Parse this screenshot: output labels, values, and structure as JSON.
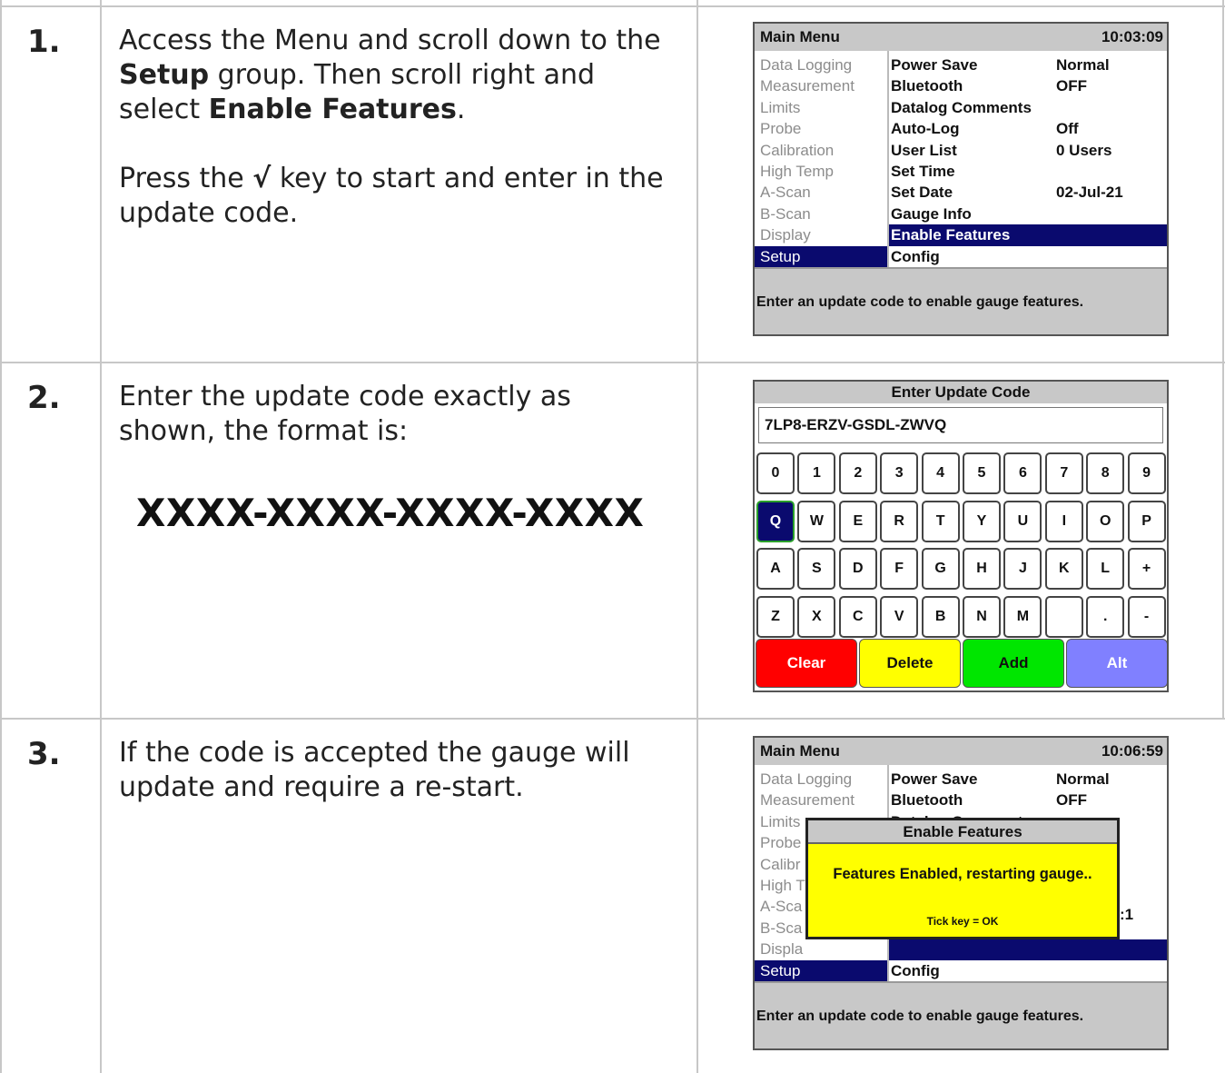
{
  "steps": [
    {
      "number": "1.",
      "p1_before": "Access the Menu and scroll down to the ",
      "p1_bold1": "Setup",
      "p1_middle": " group. Then scroll right and select ",
      "p1_bold2": "Enable Features",
      "p1_after": ".",
      "p2_before": "Press the ",
      "p2_symbol": "√",
      "p2_after": " key to start and enter in the update code."
    },
    {
      "number": "2.",
      "text": "Enter the update code exactly as shown, the format is:",
      "format": "XXXX-XXXX-XXXX-XXXX"
    },
    {
      "number": "3.",
      "text": "If the code is accepted the gauge will update and require a re-start."
    }
  ],
  "screen1": {
    "title": "Main Menu",
    "time": "10:03:09",
    "left_menu": [
      "Data Logging",
      "Measurement",
      "Limits",
      "Probe",
      "Calibration",
      "High Temp",
      "A-Scan",
      "B-Scan",
      "Display",
      "Setup"
    ],
    "right_menu": [
      {
        "label": "Power Save",
        "value": "Normal"
      },
      {
        "label": "Bluetooth",
        "value": "OFF"
      },
      {
        "label": "Datalog Comments",
        "value": ""
      },
      {
        "label": "Auto-Log",
        "value": "Off"
      },
      {
        "label": "User List",
        "value": "0 Users"
      },
      {
        "label": "Set Time",
        "value": ""
      },
      {
        "label": "Set Date",
        "value": "02-Jul-21"
      },
      {
        "label": "Gauge Info",
        "value": ""
      },
      {
        "label": "Enable Features",
        "value": ""
      },
      {
        "label": "Config",
        "value": ""
      }
    ],
    "footer": "Enter an update code to enable gauge features."
  },
  "screen2": {
    "title": "Enter Update Code",
    "input_value": "7LP8-ERZV-GSDL-ZWVQ",
    "rows": [
      [
        "0",
        "1",
        "2",
        "3",
        "4",
        "5",
        "6",
        "7",
        "8",
        "9"
      ],
      [
        "Q",
        "W",
        "E",
        "R",
        "T",
        "Y",
        "U",
        "I",
        "O",
        "P"
      ],
      [
        "A",
        "S",
        "D",
        "F",
        "G",
        "H",
        "J",
        "K",
        "L",
        "+"
      ],
      [
        "Z",
        "X",
        "C",
        "V",
        "B",
        "N",
        "M",
        "",
        ".",
        "-"
      ]
    ],
    "function_keys": [
      {
        "label": "Clear",
        "bg": "#ff0000",
        "fg": "#ffffff"
      },
      {
        "label": "Delete",
        "bg": "#ffff00",
        "fg": "#111111"
      },
      {
        "label": "Add",
        "bg": "#00e600",
        "fg": "#111111"
      },
      {
        "label": "Alt",
        "bg": "#8080ff",
        "fg": "#ffffff"
      }
    ]
  },
  "screen3": {
    "title": "Main Menu",
    "time": "10:06:59",
    "left_menu": [
      "Data Logging",
      "Measurement",
      "Limits",
      "Probe",
      "Calibr",
      "High T",
      "A-Sca",
      "B-Sca",
      "Displa",
      "Setup"
    ],
    "right_menu": [
      {
        "label": "Power Save",
        "value": "Normal"
      },
      {
        "label": "Bluetooth",
        "value": "OFF"
      },
      {
        "label": "Datalog Comments",
        "value": ""
      }
    ],
    "right_config": "Config",
    "partial_value": ":1",
    "popup": {
      "title": "Enable Features",
      "message": "Features Enabled, restarting gauge..",
      "tick": "Tick key = OK"
    },
    "footer": "Enter an update code to enable gauge features."
  },
  "colors": {
    "selection": "#0a0a6e",
    "title_bar": "#c8c8c8",
    "popup_bg": "#ffff00"
  }
}
